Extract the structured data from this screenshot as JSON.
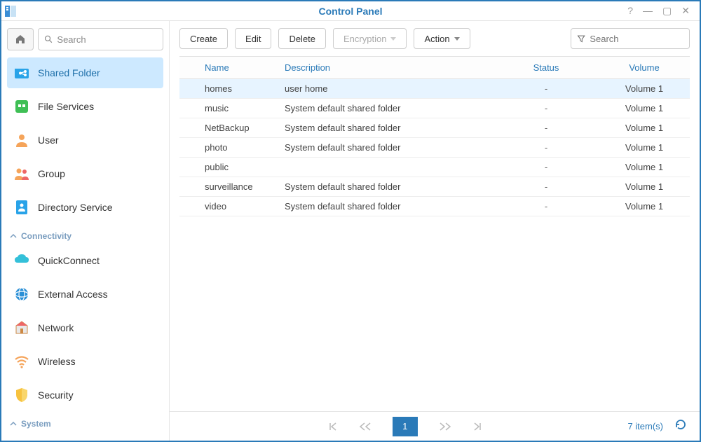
{
  "window": {
    "title": "Control Panel"
  },
  "sidebar": {
    "search_placeholder": "Search",
    "items": [
      {
        "label": "Shared Folder"
      },
      {
        "label": "File Services"
      },
      {
        "label": "User"
      },
      {
        "label": "Group"
      },
      {
        "label": "Directory Service"
      }
    ],
    "section_connectivity": "Connectivity",
    "connectivity_items": [
      {
        "label": "QuickConnect"
      },
      {
        "label": "External Access"
      },
      {
        "label": "Network"
      },
      {
        "label": "Wireless"
      },
      {
        "label": "Security"
      }
    ],
    "section_system": "System"
  },
  "toolbar": {
    "create": "Create",
    "edit": "Edit",
    "delete": "Delete",
    "encryption": "Encryption",
    "action": "Action",
    "filter_placeholder": "Search"
  },
  "table": {
    "columns": {
      "name": "Name",
      "description": "Description",
      "status": "Status",
      "volume": "Volume"
    },
    "rows": [
      {
        "name": "homes",
        "description": "user home",
        "status": "-",
        "volume": "Volume 1"
      },
      {
        "name": "music",
        "description": "System default shared folder",
        "status": "-",
        "volume": "Volume 1"
      },
      {
        "name": "NetBackup",
        "description": "System default shared folder",
        "status": "-",
        "volume": "Volume 1"
      },
      {
        "name": "photo",
        "description": "System default shared folder",
        "status": "-",
        "volume": "Volume 1"
      },
      {
        "name": "public",
        "description": "",
        "status": "-",
        "volume": "Volume 1"
      },
      {
        "name": "surveillance",
        "description": "System default shared folder",
        "status": "-",
        "volume": "Volume 1"
      },
      {
        "name": "video",
        "description": "System default shared folder",
        "status": "-",
        "volume": "Volume 1"
      }
    ]
  },
  "pager": {
    "page": "1",
    "count_label": "7 item(s)"
  }
}
